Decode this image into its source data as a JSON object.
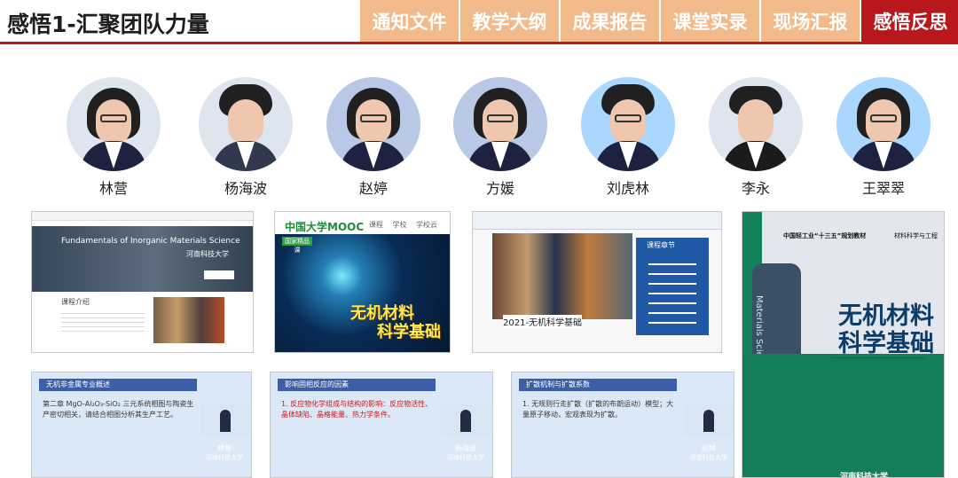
{
  "page_title": "感悟1-汇聚团队力量",
  "tabs": [
    {
      "label": "通知文件",
      "active": false
    },
    {
      "label": "教学大纲",
      "active": false
    },
    {
      "label": "成果报告",
      "active": false
    },
    {
      "label": "课堂实录",
      "active": false
    },
    {
      "label": "现场汇报",
      "active": false
    },
    {
      "label": "感悟反思",
      "active": true
    }
  ],
  "team": [
    {
      "name": "林营",
      "icon": "female-teacher-photo"
    },
    {
      "name": "杨海波",
      "icon": "male-teacher-photo"
    },
    {
      "name": "赵婷",
      "icon": "female-teacher-photo"
    },
    {
      "name": "方媛",
      "icon": "female-teacher-photo"
    },
    {
      "name": "刘虎林",
      "icon": "male-teacher-photo"
    },
    {
      "name": "李永",
      "icon": "male-teacher-photo"
    },
    {
      "name": "王翠翠",
      "icon": "female-teacher-photo"
    }
  ],
  "thumbs": {
    "course_site_title": "Fundamentals of Inorganic Materials Science",
    "course_site_logo": "河南科技大学",
    "course_site_intro": "课程介绍",
    "mooc_logo": "中国大学MOOC",
    "mooc_nav": "课程 学校 学校云",
    "mooc_badge": "国家精品课",
    "mooc_cover_title": [
      "无机材料",
      "科学基础"
    ],
    "course_page_heading": "2021-无机科学基础",
    "course_page_panel": "课程章节",
    "book_series": "中国轻工业“十三五”规划教材",
    "book_publisher": "材料科学与工程",
    "book_title": [
      "无机材料",
      "科学基础"
    ],
    "book_spine": "Materials Science",
    "university_name": "河南科技大学"
  },
  "slides": [
    {
      "title": "无机非金属专业概述",
      "text": "第二章 MgO-Al₂O₃-SiO₂ 三元系统相图与陶瓷生产密切相关，请结合相图分析其生产工艺。",
      "speaker": "林营",
      "speaker_title": "河南科技大学"
    },
    {
      "title": "影响固相反应的因素",
      "text": "1. 反应物化学组成与结构的影响：反应物活性、晶体缺陷、晶格能量、热力学条件。",
      "speaker": "杨海波",
      "speaker_title": "河南科技大学"
    },
    {
      "title": "扩散机制与扩散系数",
      "text": "1. 无规则行走扩散（扩散的布朗运动）模型；大量原子移动，宏观表现为扩散。",
      "speaker": "赵婷",
      "speaker_title": "河南科技大学"
    }
  ]
}
